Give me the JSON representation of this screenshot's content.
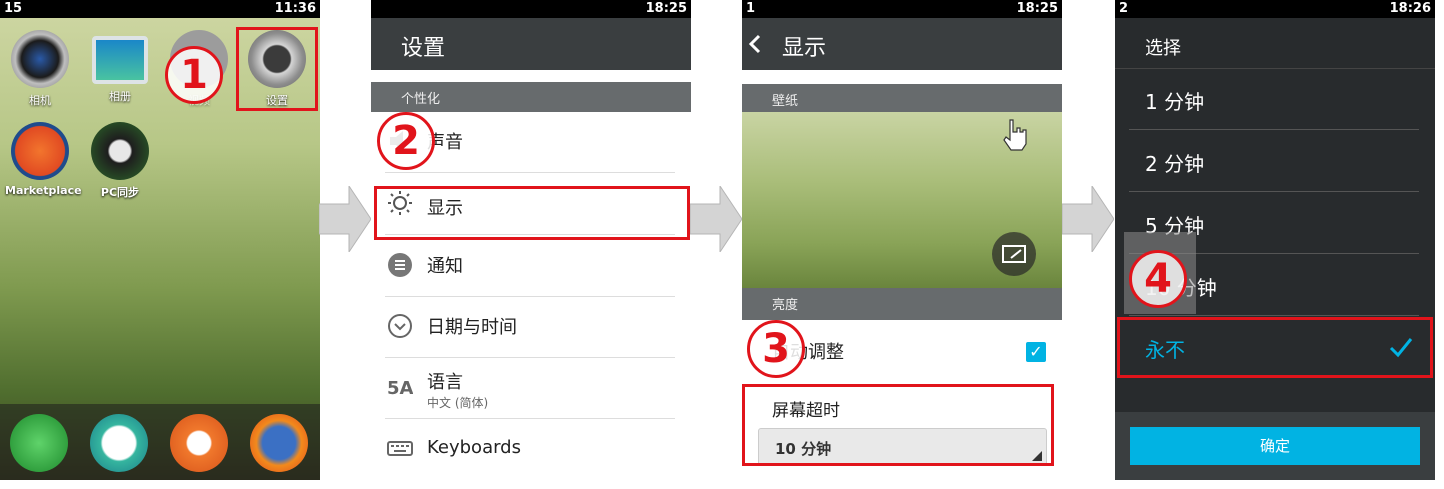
{
  "screen1": {
    "status": {
      "left": "15",
      "time": "11:36"
    },
    "apps": [
      {
        "label": "相机",
        "icon": "camera-icon"
      },
      {
        "label": "相册",
        "icon": "gallery-icon"
      },
      {
        "label": "视频",
        "icon": "video-icon"
      },
      {
        "label": "设置",
        "icon": "settings-gear-icon"
      },
      {
        "label": "Marketplace",
        "icon": "marketplace-icon"
      },
      {
        "label": "PC同步",
        "icon": "usb-sync-icon"
      }
    ],
    "dock": [
      "phone-icon",
      "messages-icon",
      "contacts-icon",
      "firefox-icon"
    ]
  },
  "screen2": {
    "status": {
      "time": "18:25"
    },
    "title": "设置",
    "section": "个性化",
    "items": [
      {
        "label": "声音",
        "icon": "speaker-icon"
      },
      {
        "label": "显示",
        "icon": "brightness-sun-icon"
      },
      {
        "label": "通知",
        "icon": "notifications-icon"
      },
      {
        "label": "日期与时间",
        "icon": "clock-icon"
      },
      {
        "label": "语言",
        "sub": "中文 (简体)",
        "icon": "language-icon"
      },
      {
        "label": "Keyboards",
        "icon": "keyboard-icon"
      }
    ]
  },
  "screen3": {
    "status": {
      "left": "1",
      "time": "18:25"
    },
    "title": "显示",
    "wallpaper_section": "壁纸",
    "brightness_section": "亮度",
    "auto_adjust": "自动调整",
    "auto_adjust_checked": true,
    "timeout_label": "屏幕超时",
    "timeout_value": "10 分钟"
  },
  "screen4": {
    "status": {
      "left": "2",
      "time": "18:26"
    },
    "title": "选择",
    "options": [
      "1 分钟",
      "2 分钟",
      "5 分钟",
      "10 分钟",
      "永不"
    ],
    "selected": "永不",
    "confirm": "确定"
  },
  "markers": [
    "1",
    "2",
    "3",
    "4"
  ],
  "colors": {
    "highlight": "#e1141b",
    "accent": "#01b3e3"
  }
}
